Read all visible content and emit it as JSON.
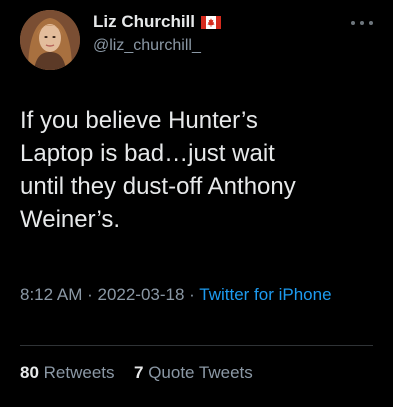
{
  "author": {
    "display_name": "Liz Churchill",
    "handle": "@liz_churchill_",
    "flag": "canada-flag-icon",
    "avatar": "profile-photo"
  },
  "more_icon": "more-options-icon",
  "tweet": {
    "text": "If you believe Hunter’s\nLaptop is bad…just wait\nuntil they dust-off Anthony\nWeiner’s."
  },
  "meta": {
    "time": "8:12 AM",
    "separator": " · ",
    "date": "2022-03-18",
    "separator2": " · ",
    "source": "Twitter for iPhone"
  },
  "stats": {
    "retweets_count": "80",
    "retweets_label": "Retweets",
    "quotes_count": "7",
    "quotes_label": "Quote Tweets"
  },
  "colors": {
    "background": "#000000",
    "text": "#e7e9ea",
    "secondary": "#8b98a5",
    "link": "#1d9bf0",
    "divider": "#2f3336"
  }
}
